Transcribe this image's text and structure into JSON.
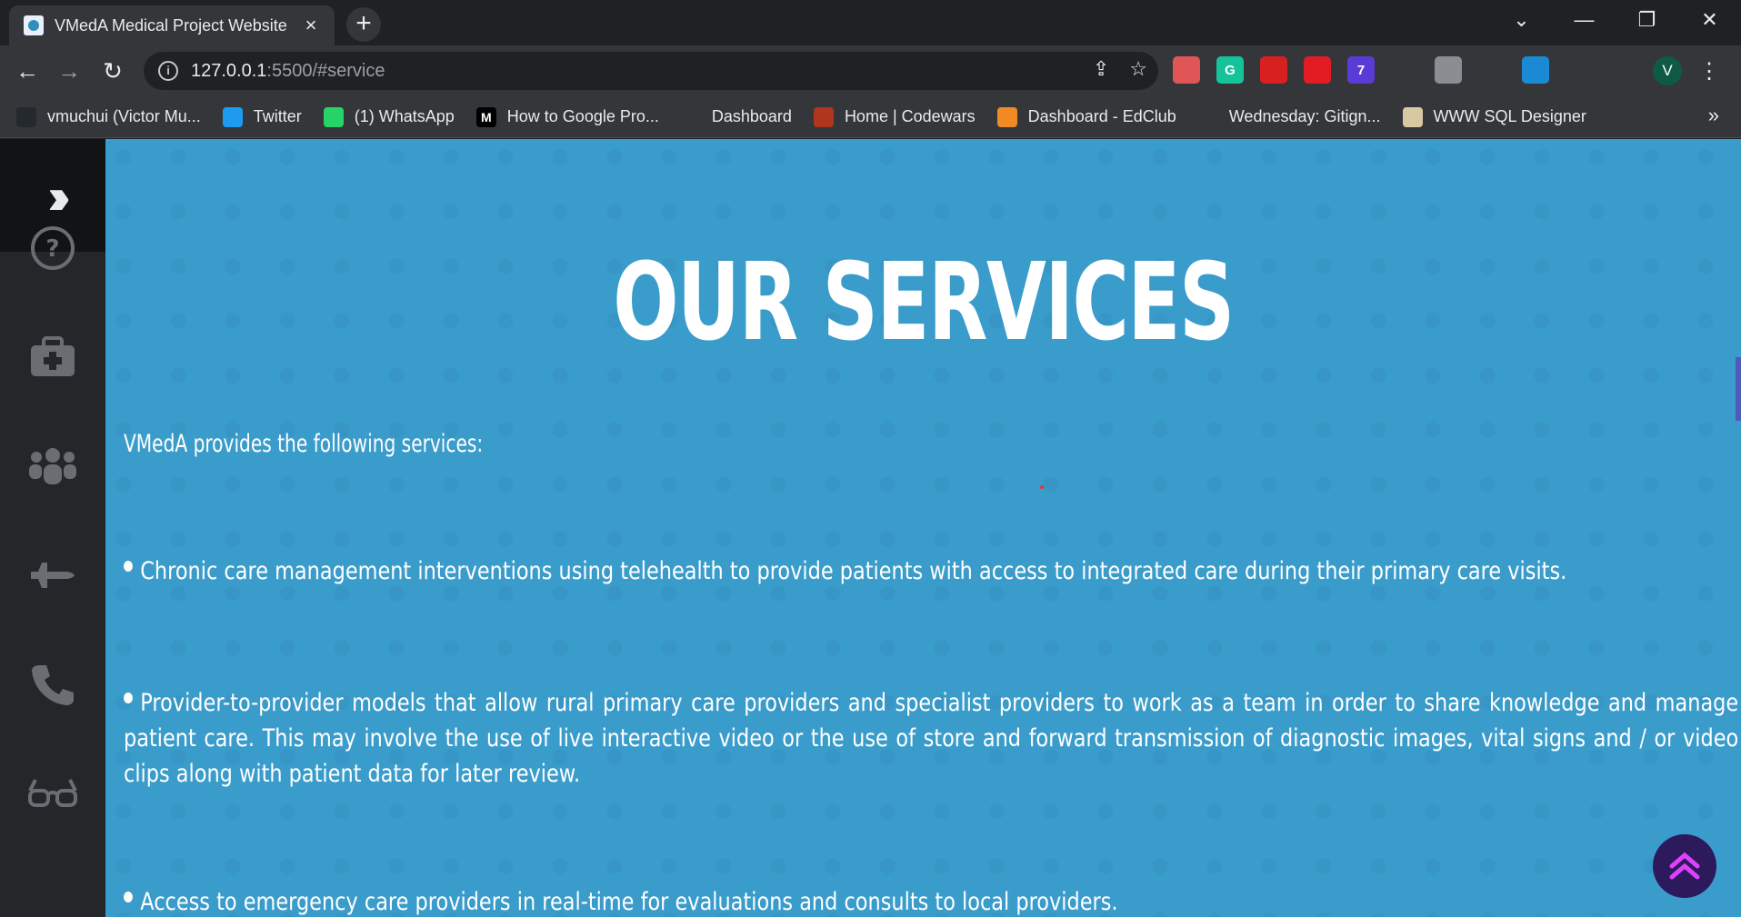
{
  "browser": {
    "tab": {
      "title": "VMedA Medical Project Website"
    },
    "url": {
      "host": "127.0.0.1",
      "path": ":5500/#service"
    },
    "bookmarks": [
      {
        "label": "vmuchui (Victor Mu...",
        "icon": "github-icon",
        "color": "#24292e",
        "glyph": ""
      },
      {
        "label": "Twitter",
        "icon": "twitter-icon",
        "color": "#1d9bf0",
        "glyph": ""
      },
      {
        "label": "(1) WhatsApp",
        "icon": "whatsapp-icon",
        "color": "#25d366",
        "glyph": ""
      },
      {
        "label": "How to Google Pro...",
        "icon": "medium-icon",
        "color": "#000000",
        "glyph": "M"
      },
      {
        "label": "Dashboard",
        "icon": "palm-tree-icon",
        "color": "#35363a",
        "glyph": ""
      },
      {
        "label": "Home | Codewars",
        "icon": "codewars-icon",
        "color": "#b1361e",
        "glyph": ""
      },
      {
        "label": "Dashboard - EdClub",
        "icon": "edclub-icon",
        "color": "#f08a24",
        "glyph": ""
      },
      {
        "label": "Wednesday: Gitign...",
        "icon": "palm-tree-icon",
        "color": "#35363a",
        "glyph": ""
      },
      {
        "label": "WWW SQL Designer",
        "icon": "sql-designer-icon",
        "color": "#d9c9a3",
        "glyph": ""
      }
    ],
    "extensions": [
      {
        "name": "video-extension-icon",
        "color": "#e05555",
        "glyph": ""
      },
      {
        "name": "grammarly-icon",
        "color": "#15c39a",
        "glyph": "G"
      },
      {
        "name": "red-extension-icon",
        "color": "#d92020",
        "glyph": ""
      },
      {
        "name": "adblock-icon",
        "color": "#e31b23",
        "glyph": ""
      },
      {
        "name": "badge-extension-icon",
        "color": "#5b3bd6",
        "glyph": "7"
      },
      {
        "name": "cloud-extension-icon",
        "color": "#35363a",
        "glyph": ""
      },
      {
        "name": "shield-extension-icon",
        "color": "#8a8d91",
        "glyph": ""
      },
      {
        "name": "bolt-extension-icon",
        "color": "#35363a",
        "glyph": ""
      },
      {
        "name": "window-extension-icon",
        "color": "#1a8ad4",
        "glyph": ""
      },
      {
        "name": "puzzle-icon",
        "color": "#35363a",
        "glyph": ""
      },
      {
        "name": "sidepanel-icon",
        "color": "#35363a",
        "glyph": ""
      }
    ],
    "profile_initial": "V"
  },
  "page": {
    "heading": "OUR SERVICES",
    "intro": "VMedA provides the following services:",
    "services": [
      "Chronic care management interventions using telehealth to provide patients with access to integrated care during their primary care visits.",
      "Provider-to-provider models that allow rural primary care providers and specialist providers to work as a team in order to share knowledge and manage patient care. This may involve the use of live interactive video or the use of store and forward transmission of diagnostic images, vital signs and / or video clips along with patient data for later review.",
      "Access to emergency care providers in real-time for evaluations and consults to local providers."
    ],
    "sidebar_icons": [
      "question-circle-icon",
      "medical-kit-icon",
      "users-icon",
      "plane-icon",
      "phone-icon",
      "glasses-icon"
    ],
    "colors": {
      "content_bg": "#3a9ccb",
      "sidebar_bg": "#25262a",
      "scroll_top_bg": "#2c1a5c",
      "scroll_top_arrow": "#e040fb"
    }
  }
}
